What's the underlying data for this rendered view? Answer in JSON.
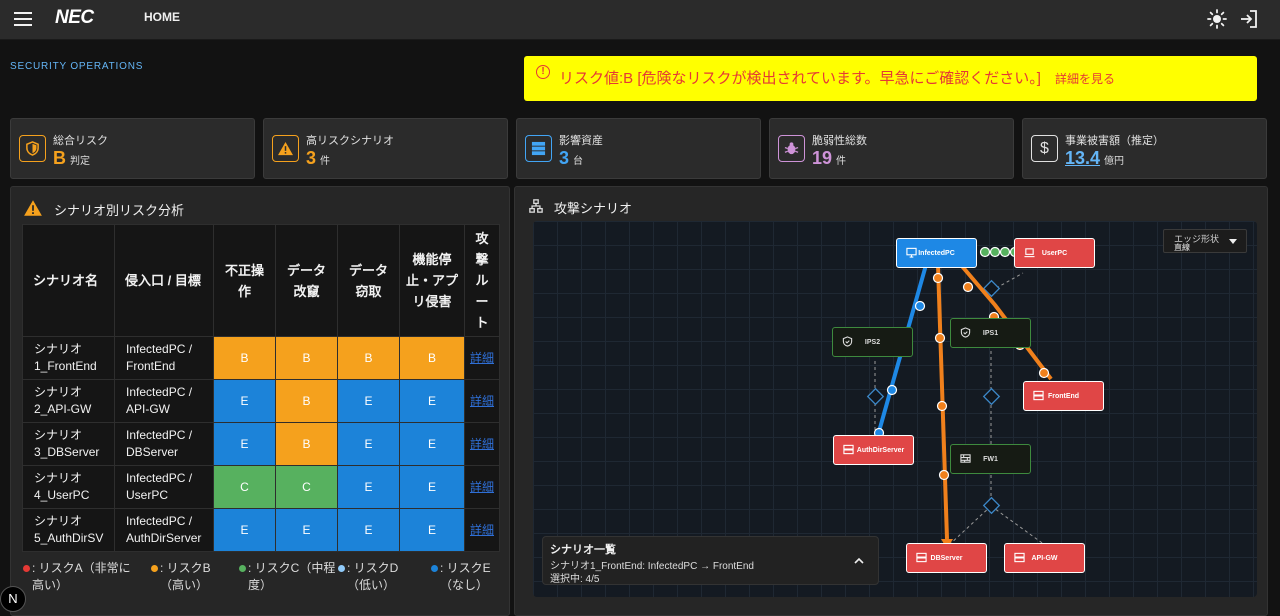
{
  "header": {
    "brand": "NEC",
    "nav_home": "HOME"
  },
  "section_label": "SECURITY OPERATIONS",
  "alert": {
    "message": "リスク値:B [危険なリスクが検出されています。早急にご確認ください。]",
    "link": "詳細を見る"
  },
  "kpis": [
    {
      "label": "総合リスク",
      "value": "B",
      "unit": "判定",
      "color": "#f5a11d",
      "icon": "shield-icon"
    },
    {
      "label": "高リスクシナリオ",
      "value": "3",
      "unit": "件",
      "color": "#f5a11d",
      "icon": "warning-icon"
    },
    {
      "label": "影響資産",
      "value": "3",
      "unit": "台",
      "color": "#42a5f5",
      "icon": "server-icon"
    },
    {
      "label": "脆弱性総数",
      "value": "19",
      "unit": "件",
      "color": "#ce93d8",
      "icon": "bug-icon"
    },
    {
      "label": "事業被害額（推定）",
      "value": "13.4",
      "unit": "億円",
      "color": "#64b5f6",
      "icon": "dollar-icon"
    }
  ],
  "risk_panel": {
    "title": "シナリオ別リスク分析",
    "headers": [
      "シナリオ名",
      "侵入口 / 目標",
      "不正操作",
      "データ改竄",
      "データ窃取",
      "機能停止・アプリ侵害",
      "攻撃ルート"
    ],
    "rows": [
      {
        "name": "シナリオ1_FrontEnd",
        "target": "InfectedPC / FrontEnd",
        "cells": [
          "B",
          "B",
          "B",
          "B"
        ],
        "link": "詳細"
      },
      {
        "name": "シナリオ2_API-GW",
        "target": "InfectedPC / API-GW",
        "cells": [
          "E",
          "B",
          "E",
          "E"
        ],
        "link": "詳細"
      },
      {
        "name": "シナリオ3_DBServer",
        "target": "InfectedPC / DBServer",
        "cells": [
          "E",
          "B",
          "E",
          "E"
        ],
        "link": "詳細"
      },
      {
        "name": "シナリオ4_UserPC",
        "target": "InfectedPC / UserPC",
        "cells": [
          "C",
          "C",
          "E",
          "E"
        ],
        "link": "詳細"
      },
      {
        "name": "シナリオ5_AuthDirSV",
        "target": "InfectedPC / AuthDirServer",
        "cells": [
          "E",
          "E",
          "E",
          "E"
        ],
        "link": "詳細"
      }
    ],
    "legend": [
      {
        "label": ": リスクA（非常に高い）",
        "color": "#e53935"
      },
      {
        "label": ": リスクB（高い）",
        "color": "#f5a11d"
      },
      {
        "label": ": リスクC（中程度）",
        "color": "#57b15f"
      },
      {
        "label": ": リスクD（低い）",
        "color": "#90caf9"
      },
      {
        "label": ": リスクE（なし）",
        "color": "#1c83d9"
      }
    ]
  },
  "attack_panel": {
    "title": "攻撃シナリオ",
    "edge_select": {
      "label": "エッジ形状",
      "value": "直線"
    },
    "nodes": {
      "infected": "InfectedPC",
      "userpc": "UserPC",
      "ips2": "IPS2",
      "ips1": "IPS1",
      "frontend": "FrontEnd",
      "authdir": "AuthDirServer",
      "fw1": "FW1",
      "db": "DBServer",
      "apigw": "API-GW"
    },
    "scenario_box": {
      "title": "シナリオ一覧",
      "current": "シナリオ1_FrontEnd: InfectedPC → FrontEnd",
      "selected": "選択中: 4/5"
    }
  },
  "next_badge": "N"
}
